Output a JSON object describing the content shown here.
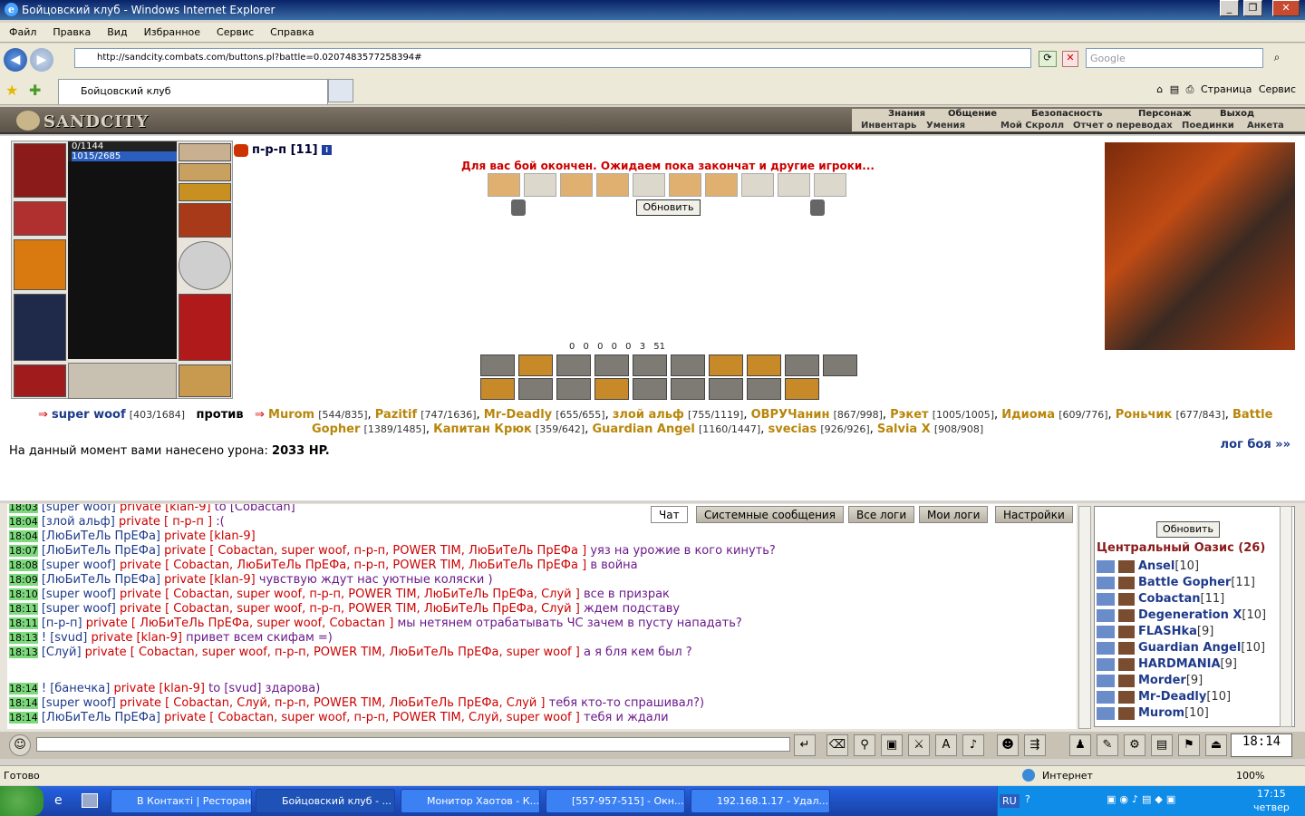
{
  "window": {
    "title": "Бойцовский клуб - Windows Internet Explorer"
  },
  "menu": [
    "Файл",
    "Правка",
    "Вид",
    "Избранное",
    "Сервис",
    "Справка"
  ],
  "address": {
    "url": "http://sandcity.combats.com/buttons.pl?battle=0.0207483577258394#",
    "search_placeholder": "Google"
  },
  "tab": {
    "label": "Бойцовский клуб"
  },
  "toolbar_right": {
    "page": "Страница",
    "service": "Сервис"
  },
  "game": {
    "logo": "SANDCITY",
    "nav_top": [
      "Знания",
      "Общение",
      "Безопасность",
      "Персонаж",
      "Выход"
    ],
    "nav_bottom": [
      "Инвентарь",
      "Умения",
      "Мой Скролл",
      "Отчет о переводах",
      "Поединки",
      "Анкета"
    ],
    "hp": "0/1144",
    "mana": "1015/2685",
    "player": "п-р-п [11]",
    "battle_message": "Для вас бой окончен. Ожидаем пока закончат и другие игроки...",
    "refresh": "Обновить",
    "counters": "0 0 0 0 0 3 51",
    "me": "super woof",
    "me_hp": "[403/1684]",
    "vs": "против",
    "enemies": [
      {
        "n": "Murom",
        "hp": "[544/835]"
      },
      {
        "n": "Pazitif",
        "hp": "[747/1636]"
      },
      {
        "n": "Mr-Deadly",
        "hp": "[655/655]"
      },
      {
        "n": "злой альф",
        "hp": "[755/1119]"
      },
      {
        "n": "ОВРУЧанин",
        "hp": "[867/998]"
      },
      {
        "n": "Рэкет",
        "hp": "[1005/1005]"
      },
      {
        "n": "Идиома",
        "hp": "[609/776]"
      },
      {
        "n": "Роньчик",
        "hp": "[677/843]"
      },
      {
        "n": "Battle Gopher",
        "hp": "[1389/1485]"
      },
      {
        "n": "Капитан Крюк",
        "hp": "[359/642]"
      },
      {
        "n": "Guardian Angel",
        "hp": "[1160/1447]"
      },
      {
        "n": "svecias",
        "hp": "[926/926]"
      },
      {
        "n": "Salvia X",
        "hp": "[908/908]"
      }
    ],
    "damage_label": "На данный момент вами нанесено урона:",
    "damage_value": "2033 HP.",
    "battle_log": "лог боя »»"
  },
  "chat": {
    "tabs": [
      "Чат",
      "Системные сообщения",
      "Все логи",
      "Мои логи",
      "Настройки"
    ],
    "lines": [
      {
        "t": "18:03",
        "n": "[super woof]",
        "p": "private [klan-9]",
        "m": "to [Cobactan]"
      },
      {
        "t": "18:04",
        "n": "[злой альф]",
        "p": "private [ п-р-п ]",
        "m": ":("
      },
      {
        "t": "18:04",
        "n": "[ЛюБиТеЛь ПрЕФа]",
        "p": "private [klan-9]",
        "m": ""
      },
      {
        "t": "18:07",
        "n": "[ЛюБиТеЛь ПрЕФа]",
        "p": "private [ Cobactan, super woof, п-р-п, POWER TIM, ЛюБиТеЛь ПрЕФа ]",
        "m": "уяз на урожие в кого кинуть?"
      },
      {
        "t": "18:08",
        "n": "[super woof]",
        "p": "private [ Cobactan, ЛюБиТеЛь ПрЕФа, п-р-п, POWER TIM, ЛюБиТеЛь ПрЕФа ]",
        "m": "в война"
      },
      {
        "t": "18:09",
        "n": "[ЛюБиТеЛь ПрЕФа]",
        "p": "private [klan-9]",
        "m": "чувствую ждут нас уютные коляски )"
      },
      {
        "t": "18:10",
        "n": "[super woof]",
        "p": "private [ Cobactan, super woof, п-р-п, POWER TIM, ЛюБиТеЛь ПрЕФа, Слуй ]",
        "m": "все в призрак"
      },
      {
        "t": "18:11",
        "n": "[super woof]",
        "p": "private [ Cobactan, super woof, п-р-п, POWER TIM, ЛюБиТеЛь ПрЕФа, Слуй ]",
        "m": "ждем подставу"
      },
      {
        "t": "18:11",
        "n": "[п-р-п]",
        "p": "private [ ЛюБиТеЛь ПрЕФа, super woof, Cobactan ]",
        "m": "мы нетянем отрабатывать ЧС зачем в пусту нападать?"
      },
      {
        "t": "18:13",
        "n": "! [svud]",
        "p": "private [klan-9]",
        "m": "привет всем скифам =)"
      },
      {
        "t": "18:13",
        "n": "[Слуй]",
        "p": "private [ Cobactan, super woof, п-р-п, POWER TIM, ЛюБиТеЛь ПрЕФа, super woof ]",
        "m": "а я бля кем был ?"
      },
      {
        "t": "18:14",
        "n": "! [банечка]",
        "p": "private [klan-9]",
        "m": "to [svud]          здарова)"
      },
      {
        "t": "18:14",
        "n": "[super woof]",
        "p": "private [ Cobactan, Слуй, п-р-п, POWER TIM, ЛюБиТеЛь ПрЕФа, Слуй ]",
        "m": "тебя кто-то спрашивал?)"
      },
      {
        "t": "18:14",
        "n": "[ЛюБиТеЛь ПрЕФа]",
        "p": "private [ Cobactan, super woof, п-р-п, POWER TIM, Слуй, super woof ]",
        "m": "тебя и ждали"
      }
    ]
  },
  "users": {
    "refresh": "Обновить",
    "location": "Центральный Оазис (26)",
    "list": [
      {
        "n": "Ansel",
        "l": "[10]"
      },
      {
        "n": "Battle Gopher",
        "l": "[11]"
      },
      {
        "n": "Cobactan",
        "l": "[11]"
      },
      {
        "n": "Degeneration X",
        "l": "[10]"
      },
      {
        "n": "FLASHka",
        "l": "[9]"
      },
      {
        "n": "Guardian Angel",
        "l": "[10]"
      },
      {
        "n": "HARDMANIA",
        "l": "[9]"
      },
      {
        "n": "Morder",
        "l": "[9]"
      },
      {
        "n": "Mr-Deadly",
        "l": "[10]"
      },
      {
        "n": "Murom",
        "l": "[10]"
      }
    ]
  },
  "clock": {
    "time": "18:14"
  },
  "status": {
    "text": "Готово",
    "zone": "Интернет",
    "zoom": "100%"
  },
  "taskbar": {
    "tasks": [
      "В Контакті | Ресторан...",
      "Бойцовский клуб - ...",
      "Монитор Хаотов - К...",
      "[557-957-515] - Окн...",
      "192.168.1.17 - Удал..."
    ],
    "lang": "RU",
    "time": "17:15",
    "day": "четвер"
  }
}
